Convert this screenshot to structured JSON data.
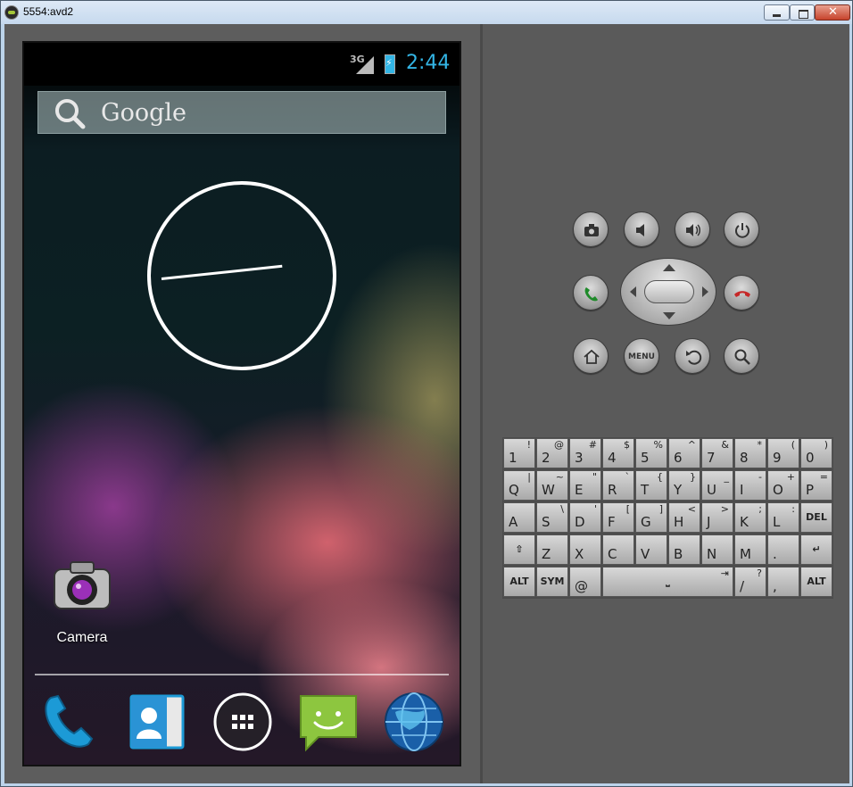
{
  "window": {
    "title": "5554:avd2",
    "controls": {
      "minimize": "minimize",
      "maximize": "maximize",
      "close": "close"
    }
  },
  "phone": {
    "status_bar": {
      "network": "3G",
      "time": "2:44",
      "battery_color": "#33b5e5"
    },
    "search": {
      "label": "Google"
    },
    "apps": [
      {
        "label": "Camera",
        "icon": "camera-icon"
      }
    ],
    "dock": [
      {
        "name": "phone",
        "icon": "phone-icon"
      },
      {
        "name": "contacts",
        "icon": "contacts-icon"
      },
      {
        "name": "all-apps",
        "icon": "apps-grid-icon"
      },
      {
        "name": "messaging",
        "icon": "messaging-icon"
      },
      {
        "name": "browser",
        "icon": "globe-icon"
      }
    ]
  },
  "hardware": {
    "menu_label": "MENU"
  },
  "keyboard": {
    "rows": [
      [
        {
          "k": "1",
          "a": "!"
        },
        {
          "k": "2",
          "a": "@"
        },
        {
          "k": "3",
          "a": "#"
        },
        {
          "k": "4",
          "a": "$"
        },
        {
          "k": "5",
          "a": "%"
        },
        {
          "k": "6",
          "a": "^"
        },
        {
          "k": "7",
          "a": "&"
        },
        {
          "k": "8",
          "a": "*"
        },
        {
          "k": "9",
          "a": "("
        },
        {
          "k": "0",
          "a": ")"
        }
      ],
      [
        {
          "k": "Q",
          "a": "|"
        },
        {
          "k": "W",
          "a": "~"
        },
        {
          "k": "E",
          "a": "\""
        },
        {
          "k": "R",
          "a": "`"
        },
        {
          "k": "T",
          "a": "{"
        },
        {
          "k": "Y",
          "a": "}"
        },
        {
          "k": "U",
          "a": "_"
        },
        {
          "k": "I",
          "a": "-"
        },
        {
          "k": "O",
          "a": "+"
        },
        {
          "k": "P",
          "a": "="
        }
      ],
      [
        {
          "k": "A",
          "a": ""
        },
        {
          "k": "S",
          "a": "\\"
        },
        {
          "k": "D",
          "a": "'"
        },
        {
          "k": "F",
          "a": "["
        },
        {
          "k": "G",
          "a": "]"
        },
        {
          "k": "H",
          "a": "<"
        },
        {
          "k": "J",
          "a": ">"
        },
        {
          "k": "K",
          "a": ";"
        },
        {
          "k": "L",
          "a": ":"
        },
        {
          "k": "DEL",
          "a": "",
          "mod": true
        }
      ],
      [
        {
          "k": "⇧",
          "a": "",
          "mod": true
        },
        {
          "k": "Z",
          "a": ""
        },
        {
          "k": "X",
          "a": ""
        },
        {
          "k": "C",
          "a": ""
        },
        {
          "k": "V",
          "a": ""
        },
        {
          "k": "B",
          "a": ""
        },
        {
          "k": "N",
          "a": ""
        },
        {
          "k": "M",
          "a": ""
        },
        {
          "k": ".",
          "a": ""
        },
        {
          "k": "↵",
          "a": "",
          "mod": true
        }
      ],
      [
        {
          "k": "ALT",
          "a": "",
          "mod": true
        },
        {
          "k": "SYM",
          "a": "",
          "mod": true
        },
        {
          "k": "@",
          "a": ""
        },
        {
          "k": "⎵",
          "a": "⇥",
          "mod": true,
          "wide": true
        },
        {
          "k": "/",
          "a": "?"
        },
        {
          "k": ",",
          "a": ""
        },
        {
          "k": "ALT",
          "a": "",
          "mod": true
        }
      ]
    ]
  }
}
